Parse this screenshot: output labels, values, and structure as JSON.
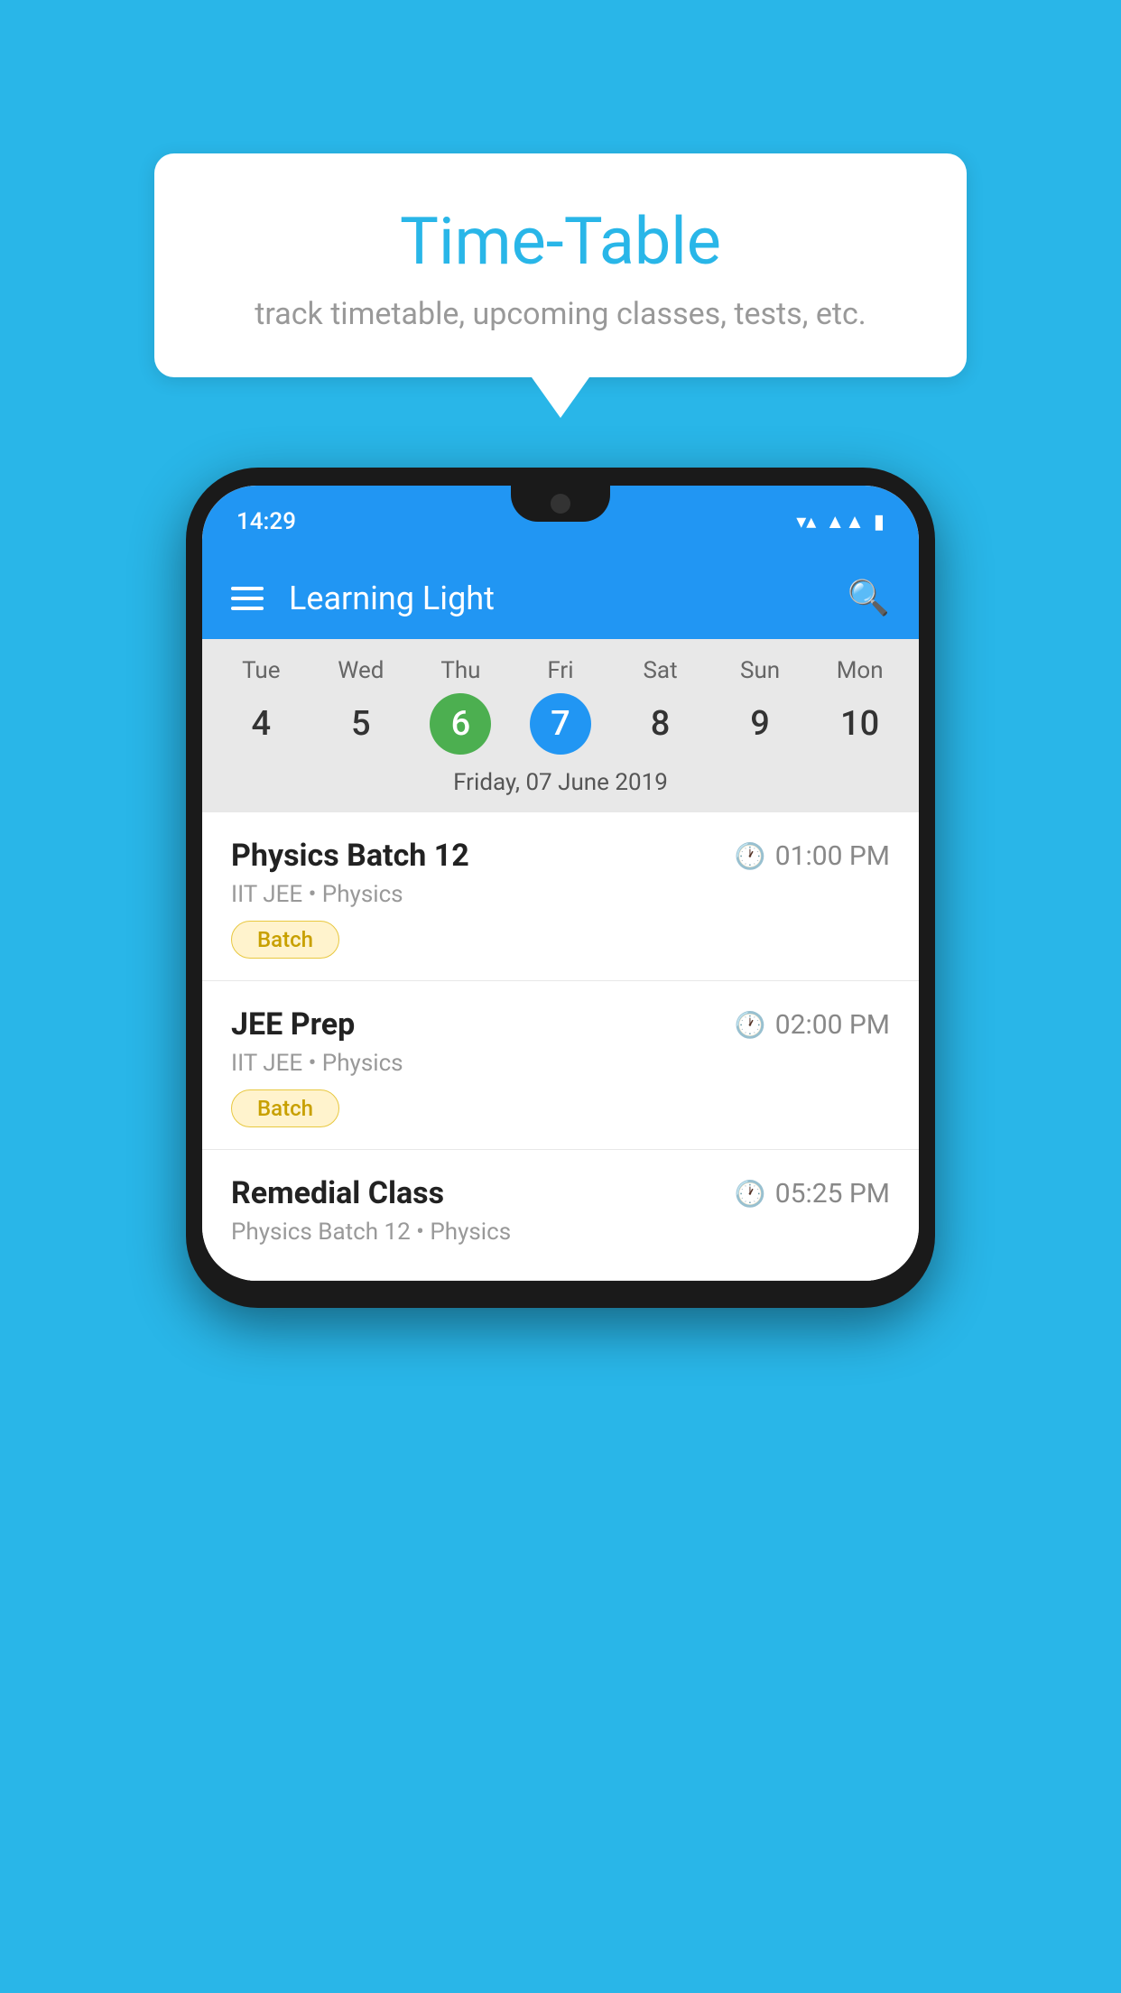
{
  "page": {
    "bg_color": "#29b6e8"
  },
  "speech_bubble": {
    "title": "Time-Table",
    "subtitle": "track timetable, upcoming classes, tests, etc."
  },
  "status_bar": {
    "time": "14:29",
    "wifi_icon": "wifi",
    "signal_icon": "signal",
    "battery_icon": "battery"
  },
  "app_bar": {
    "title": "Learning Light",
    "menu_icon": "menu",
    "search_icon": "search"
  },
  "calendar": {
    "days": [
      {
        "label": "Tue",
        "num": "4"
      },
      {
        "label": "Wed",
        "num": "5"
      },
      {
        "label": "Thu",
        "num": "6",
        "state": "today"
      },
      {
        "label": "Fri",
        "num": "7",
        "state": "selected"
      },
      {
        "label": "Sat",
        "num": "8"
      },
      {
        "label": "Sun",
        "num": "9"
      },
      {
        "label": "Mon",
        "num": "10"
      }
    ],
    "selected_date_label": "Friday, 07 June 2019"
  },
  "schedule_items": [
    {
      "title": "Physics Batch 12",
      "time": "01:00 PM",
      "subtitle": "IIT JEE • Physics",
      "badge": "Batch"
    },
    {
      "title": "JEE Prep",
      "time": "02:00 PM",
      "subtitle": "IIT JEE • Physics",
      "badge": "Batch"
    },
    {
      "title": "Remedial Class",
      "time": "05:25 PM",
      "subtitle": "Physics Batch 12 • Physics",
      "badge": ""
    }
  ]
}
